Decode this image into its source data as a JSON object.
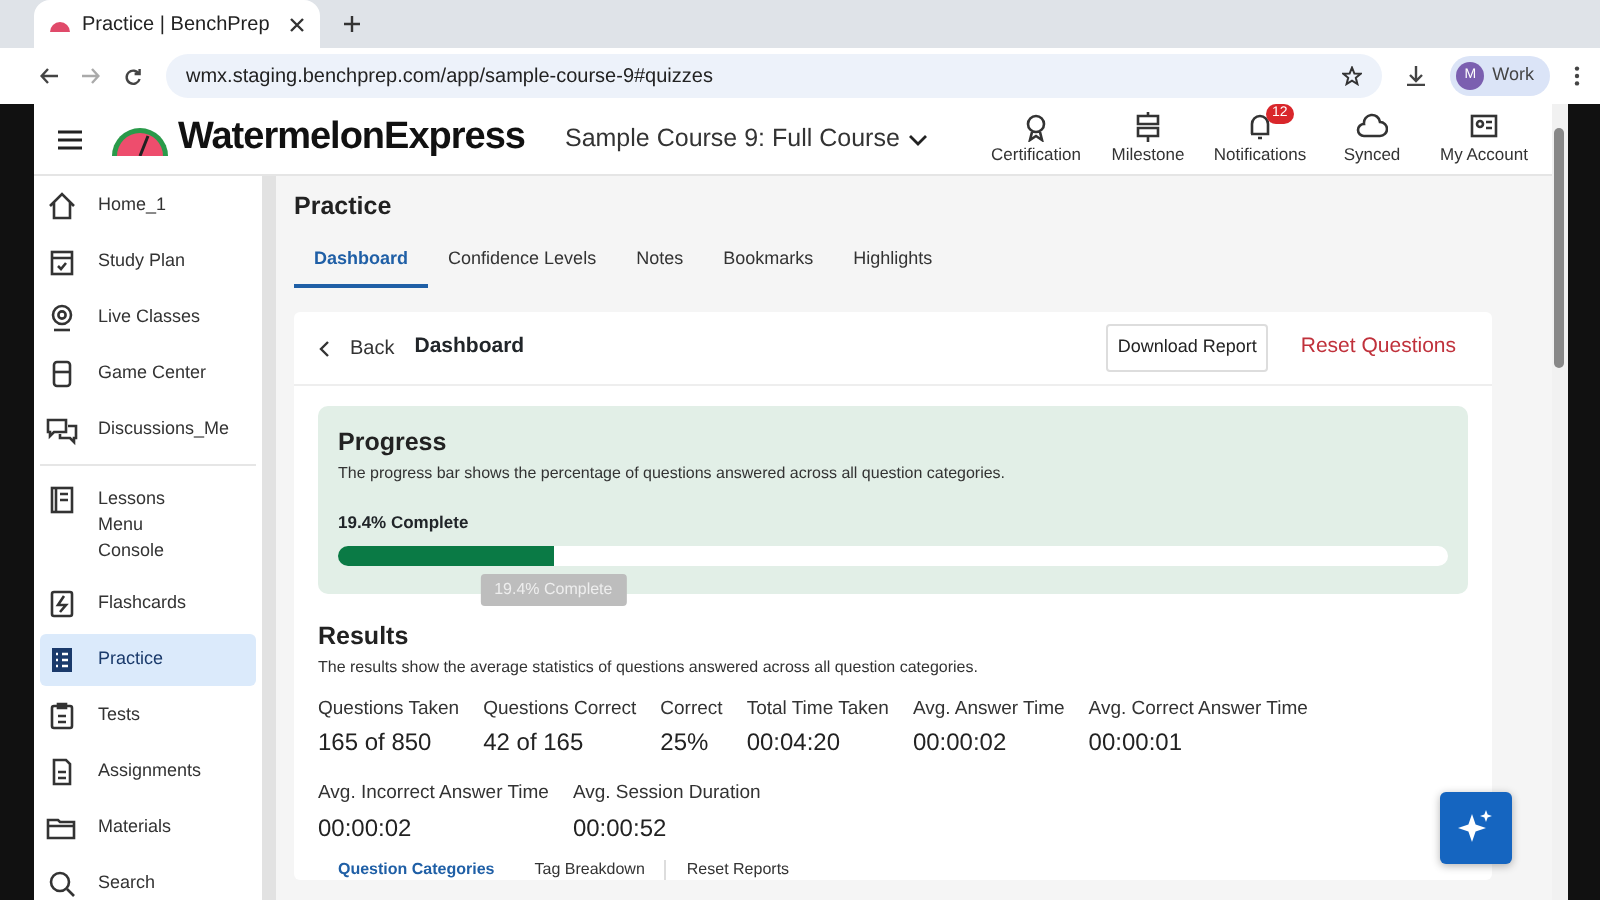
{
  "browser": {
    "tab_title": "Practice | BenchPrep",
    "url": "wmx.staging.benchprep.com/app/sample-course-9#quizzes",
    "profile_initial": "M",
    "profile_label": "Work"
  },
  "header": {
    "logo_text": "WatermelonExpress",
    "course": "Sample Course 9: Full Course",
    "nav": [
      {
        "kind": "certificate",
        "label": "Certification"
      },
      {
        "kind": "milestone",
        "label": "Milestone"
      },
      {
        "kind": "bell",
        "label": "Notifications",
        "badge": "12"
      },
      {
        "kind": "cloud",
        "label": "Synced"
      },
      {
        "kind": "card",
        "label": "My Account"
      }
    ]
  },
  "sidebar": {
    "items": [
      {
        "kind": "home",
        "lines": [
          "Home_1"
        ],
        "selected": false
      },
      {
        "kind": "calendar",
        "lines": [
          "Study Plan"
        ],
        "selected": false
      },
      {
        "kind": "webcam",
        "lines": [
          "Live Classes"
        ],
        "selected": false
      },
      {
        "kind": "game",
        "lines": [
          "Game Center"
        ],
        "selected": false
      },
      {
        "kind": "chat",
        "lines": [
          "Discussions_Me"
        ],
        "selected": false
      },
      {
        "kind": "book",
        "lines": [
          "Lessons",
          "Menu",
          "Console"
        ],
        "selected": false
      },
      {
        "kind": "flash",
        "lines": [
          "Flashcards"
        ],
        "selected": false
      },
      {
        "kind": "grid",
        "lines": [
          "Practice"
        ],
        "selected": true
      },
      {
        "kind": "clipboard",
        "lines": [
          "Tests"
        ],
        "selected": false
      },
      {
        "kind": "file",
        "lines": [
          "Assignments"
        ],
        "selected": false
      },
      {
        "kind": "folder",
        "lines": [
          "Materials"
        ],
        "selected": false
      },
      {
        "kind": "search",
        "lines": [
          "Search"
        ],
        "selected": false
      }
    ]
  },
  "page": {
    "title": "Practice",
    "tabs": [
      {
        "label": "Dashboard",
        "selected": true
      },
      {
        "label": "Confidence Levels",
        "selected": false
      },
      {
        "label": "Notes",
        "selected": false
      },
      {
        "label": "Bookmarks",
        "selected": false
      },
      {
        "label": "Highlights",
        "selected": false
      }
    ]
  },
  "card": {
    "back": "Back",
    "title": "Dashboard",
    "download": "Download Report",
    "reset": "Reset Questions",
    "progress": {
      "title": "Progress",
      "description": "The progress bar shows the percentage of questions answered across all question categories.",
      "reading": "19.4% Complete",
      "level": 0.194,
      "tooltip": "19.4% Complete"
    },
    "results": {
      "title": "Results",
      "description": "The results show the average statistics of questions answered across all question categories.",
      "stats": [
        {
          "label": "Questions Taken",
          "value": "165 of 850"
        },
        {
          "label": "Questions Correct",
          "value": "42 of 165"
        },
        {
          "label": "Correct",
          "value": "25%"
        },
        {
          "label": "Total Time Taken",
          "value": "00:04:20"
        },
        {
          "label": "Avg. Answer Time",
          "value": "00:00:02"
        },
        {
          "label": "Avg. Correct Answer Time",
          "value": "00:00:01"
        },
        {
          "label": "Avg. Incorrect Answer Time",
          "value": "00:00:02"
        },
        {
          "label": "Avg. Session Duration",
          "value": "00:00:52"
        }
      ]
    },
    "tabs": [
      {
        "label": "Question Categories",
        "selected": true
      },
      {
        "label": "Tag Breakdown",
        "selected": false
      },
      {
        "label": "Reset Reports",
        "selected": false
      }
    ]
  }
}
